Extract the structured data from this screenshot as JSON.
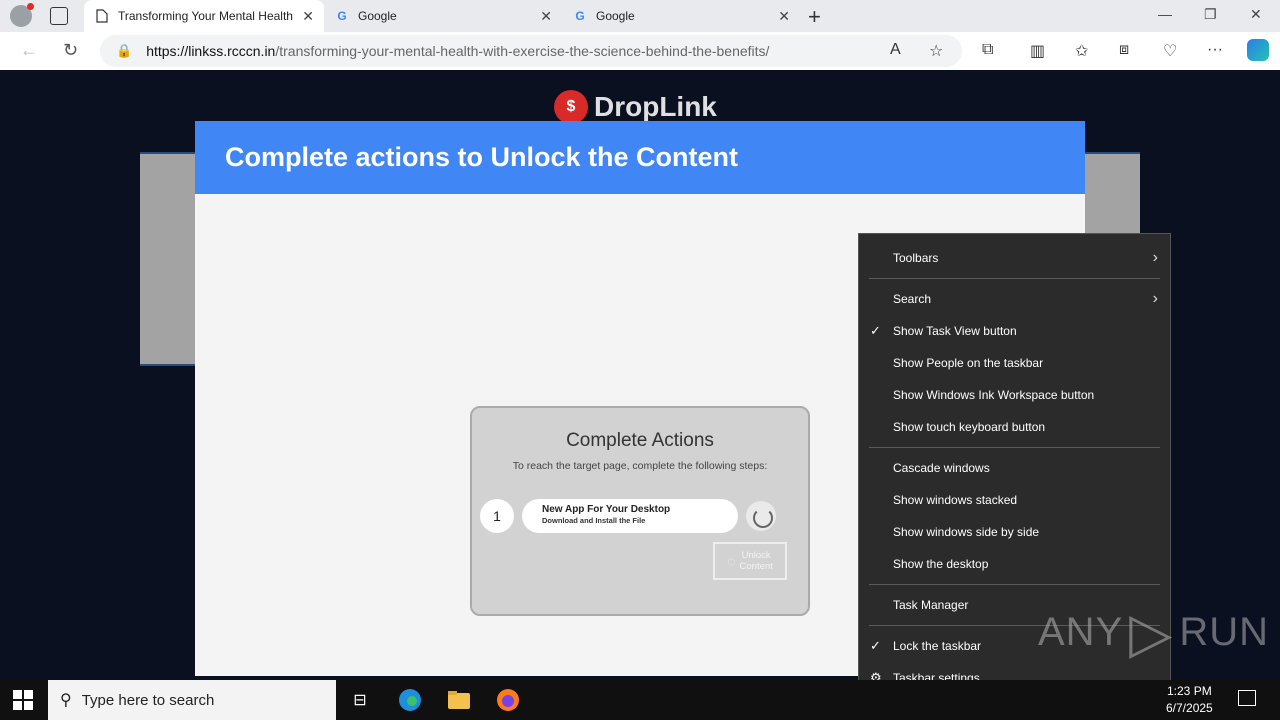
{
  "browser": {
    "tabs": [
      {
        "title": "Transforming Your Mental Health",
        "favicon": "page-icon",
        "active": true
      },
      {
        "title": "Google",
        "favicon": "google-icon",
        "active": false
      },
      {
        "title": "Google",
        "favicon": "google-icon",
        "active": false
      }
    ],
    "url_host": "https://linkss.rcccn.in",
    "url_path": "/transforming-your-mental-health-with-exercise-the-science-behind-the-benefits/"
  },
  "page": {
    "logo_text": "DropLink",
    "logo_mark": "$",
    "modal_title": "Complete actions to Unlock the Content",
    "card": {
      "title": "Complete Actions",
      "subtitle": "To reach the target page, complete the following steps:",
      "step_number": "1",
      "step_title": "New App For Your Desktop",
      "step_desc": "Download and Install the File",
      "unlock_line1": "Unlock",
      "unlock_line2": "Content"
    }
  },
  "context_menu": {
    "items": [
      {
        "label": "Toolbars",
        "submenu": true,
        "checked": false
      },
      {
        "label": "Search",
        "submenu": true,
        "checked": false
      },
      {
        "label": "Show Task View button",
        "submenu": false,
        "checked": true
      },
      {
        "label": "Show People on the taskbar",
        "submenu": false,
        "checked": false
      },
      {
        "label": "Show Windows Ink Workspace button",
        "submenu": false,
        "checked": false
      },
      {
        "label": "Show touch keyboard button",
        "submenu": false,
        "checked": false
      },
      {
        "label": "Cascade windows",
        "submenu": false,
        "checked": false
      },
      {
        "label": "Show windows stacked",
        "submenu": false,
        "checked": false
      },
      {
        "label": "Show windows side by side",
        "submenu": false,
        "checked": false
      },
      {
        "label": "Show the desktop",
        "submenu": false,
        "checked": false
      },
      {
        "label": "Task Manager",
        "submenu": false,
        "checked": false
      },
      {
        "label": "Lock the taskbar",
        "submenu": false,
        "checked": true
      },
      {
        "label": "Taskbar settings",
        "submenu": false,
        "checked": false,
        "icon": "gear-icon"
      }
    ]
  },
  "watermark": {
    "left": "ANY",
    "right": "RUN"
  },
  "taskbar": {
    "search_placeholder": "Type here to search",
    "time": "1:23 PM",
    "date": "6/7/2025"
  },
  "colors": {
    "modal_header": "#4186f5",
    "context_menu_bg": "#2b2b2b",
    "page_bg": "#0b1020"
  }
}
